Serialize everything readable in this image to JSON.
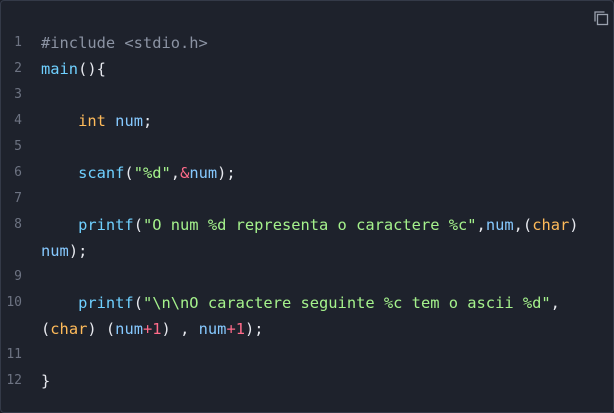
{
  "copy_button": {
    "icon": "copy-icon"
  },
  "lines": [
    {
      "n": "1",
      "tokens": [
        {
          "t": "#include <stdio.h>",
          "k": "pre"
        }
      ]
    },
    {
      "n": "2",
      "tokens": [
        {
          "t": "main",
          "k": "fn"
        },
        {
          "t": "(){",
          "k": "p"
        }
      ]
    },
    {
      "n": "3",
      "tokens": []
    },
    {
      "n": "4",
      "tokens": [
        {
          "t": "    ",
          "k": "p"
        },
        {
          "t": "int",
          "k": "kw"
        },
        {
          "t": " ",
          "k": "p"
        },
        {
          "t": "num",
          "k": "var"
        },
        {
          "t": ";",
          "k": "p"
        }
      ]
    },
    {
      "n": "5",
      "tokens": []
    },
    {
      "n": "6",
      "tokens": [
        {
          "t": "    ",
          "k": "p"
        },
        {
          "t": "scanf",
          "k": "fn"
        },
        {
          "t": "(",
          "k": "p"
        },
        {
          "t": "\"%d\"",
          "k": "str"
        },
        {
          "t": ",",
          "k": "p"
        },
        {
          "t": "&",
          "k": "op"
        },
        {
          "t": "num",
          "k": "var"
        },
        {
          "t": ");",
          "k": "p"
        }
      ]
    },
    {
      "n": "7",
      "tokens": []
    },
    {
      "n": "8",
      "tokens": [
        {
          "t": "    ",
          "k": "p"
        },
        {
          "t": "printf",
          "k": "fn"
        },
        {
          "t": "(",
          "k": "p"
        },
        {
          "t": "\"O num %d representa o caractere %c\"",
          "k": "str"
        },
        {
          "t": ",",
          "k": "p"
        },
        {
          "t": "num",
          "k": "var"
        },
        {
          "t": ",(",
          "k": "p"
        },
        {
          "t": "char",
          "k": "type"
        },
        {
          "t": ")\n",
          "k": "p"
        },
        {
          "t": "num",
          "k": "var"
        },
        {
          "t": ");",
          "k": "p"
        }
      ]
    },
    {
      "n": "9",
      "tokens": []
    },
    {
      "n": "10",
      "tokens": [
        {
          "t": "    ",
          "k": "p"
        },
        {
          "t": "printf",
          "k": "fn"
        },
        {
          "t": "(",
          "k": "p"
        },
        {
          "t": "\"\\n\\nO caractere seguinte %c tem o ascii %d\"",
          "k": "str"
        },
        {
          "t": ",\n(",
          "k": "p"
        },
        {
          "t": "char",
          "k": "type"
        },
        {
          "t": ") (",
          "k": "p"
        },
        {
          "t": "num",
          "k": "var"
        },
        {
          "t": "+",
          "k": "op"
        },
        {
          "t": "1",
          "k": "num"
        },
        {
          "t": ") , ",
          "k": "p"
        },
        {
          "t": "num",
          "k": "var"
        },
        {
          "t": "+",
          "k": "op"
        },
        {
          "t": "1",
          "k": "num"
        },
        {
          "t": ");",
          "k": "p"
        }
      ]
    },
    {
      "n": "11",
      "tokens": []
    },
    {
      "n": "12",
      "tokens": [
        {
          "t": "}",
          "k": "p"
        }
      ]
    }
  ]
}
